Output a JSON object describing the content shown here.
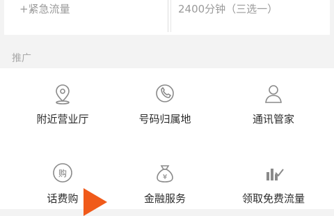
{
  "top_card": {
    "left_text": "+紧急流量",
    "right_text": "2400分钟（三选一）"
  },
  "section": {
    "title": "推广"
  },
  "tiles": [
    {
      "label": "附近营业厅",
      "icon": "location-pin-icon"
    },
    {
      "label": "号码归属地",
      "icon": "phone-icon"
    },
    {
      "label": "通讯管家",
      "icon": "person-icon"
    },
    {
      "label": "话费购",
      "icon": "coin-purchase-icon"
    },
    {
      "label": "金融服务",
      "icon": "money-bag-icon"
    },
    {
      "label": "领取免费流量",
      "icon": "bar-chart-check-icon"
    }
  ],
  "colors": {
    "accent_arrow": "#f05a1a",
    "icon_stroke": "#8a8a8a"
  }
}
